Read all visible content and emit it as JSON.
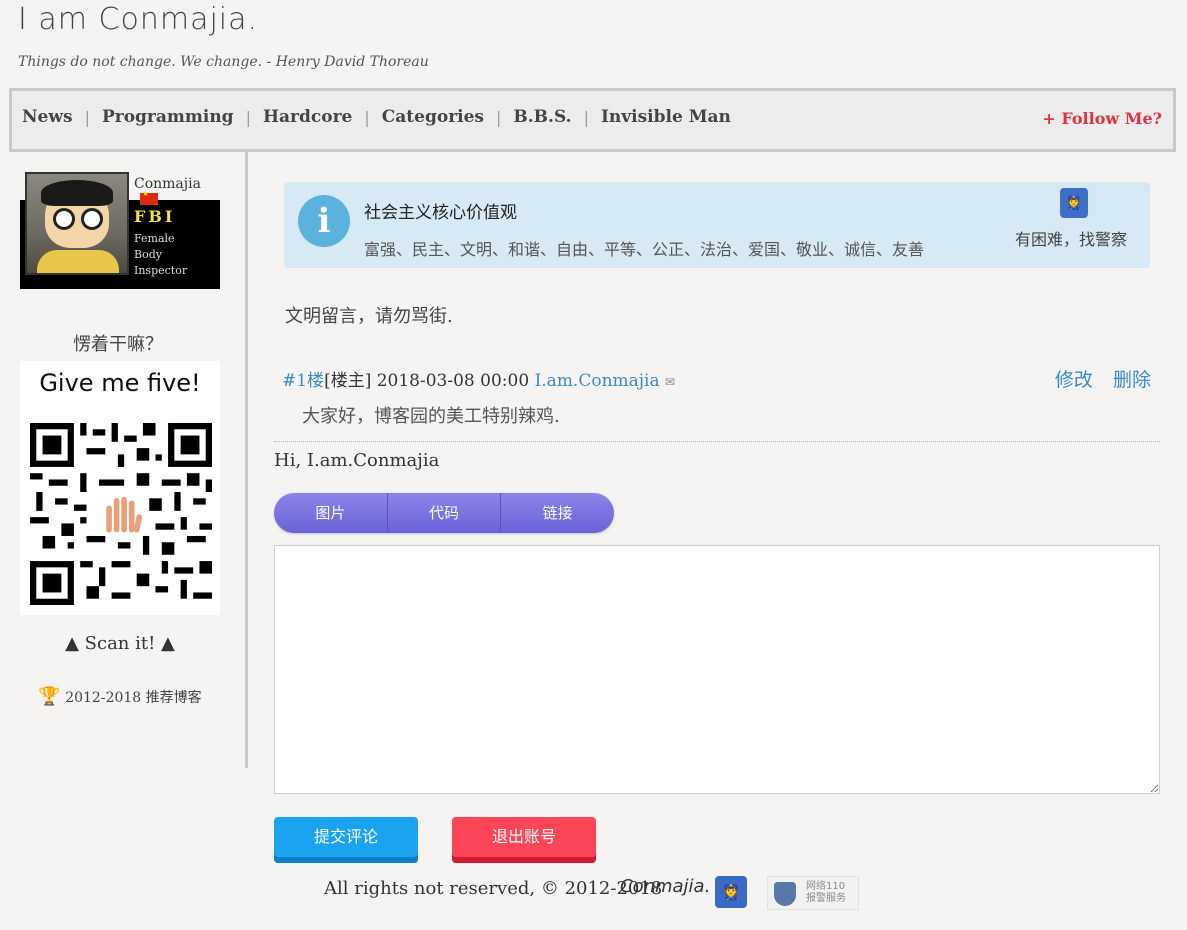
{
  "header": {
    "site_title": "I am Conmajia.",
    "motto": "Things do not change. We change. - Henry David Thoreau"
  },
  "nav": {
    "items": [
      "News",
      "Programming",
      "Hardcore",
      "Categories",
      "B.B.S.",
      "Invisible Man"
    ],
    "follow": "+ Follow Me?"
  },
  "sidebar": {
    "profile_name": "Conmajia",
    "fbi": "FBI",
    "fbi_desc": [
      "Female",
      "Body",
      "Inspector"
    ],
    "what_doing": "愣着干嘛？",
    "qr_title": "Give me five!",
    "scan": "▲ Scan it! ▲",
    "award": "2012-2018 推荐博客"
  },
  "notice": {
    "title": "社会主义核心价值观",
    "values": "富强、民主、文明、和谐、自由、平等、公正、法治、爱国、敬业、诚信、友善",
    "police_text": "有困难，找警察"
  },
  "main": {
    "civil_notice": "文明留言，请勿骂街.",
    "comment": {
      "floor": "#1楼",
      "role": "[楼主]",
      "date": "2018-03-08 00:00",
      "author": "I.am.Conmajia",
      "edit": "修改",
      "delete": "删除",
      "body": "大家好，博客园的美工特别辣鸡."
    },
    "greeting": "Hi, I.am.Conmajia",
    "toolbar": [
      "图片",
      "代码",
      "链接"
    ],
    "submit": "提交评论",
    "logout": "退出账号"
  },
  "footer": {
    "copyright": "All rights not reserved, © 2012-2018",
    "signature": "Conmajia.",
    "badge_line1": "网络110",
    "badge_line2": "报警服务"
  },
  "colors": {
    "link": "#3a8ac9",
    "follow": "#e0323c",
    "submit": "#1aa3ee",
    "logout": "#fd4558",
    "toolbar": "#7a73e0",
    "notice_bg": "#d7e9f4"
  }
}
